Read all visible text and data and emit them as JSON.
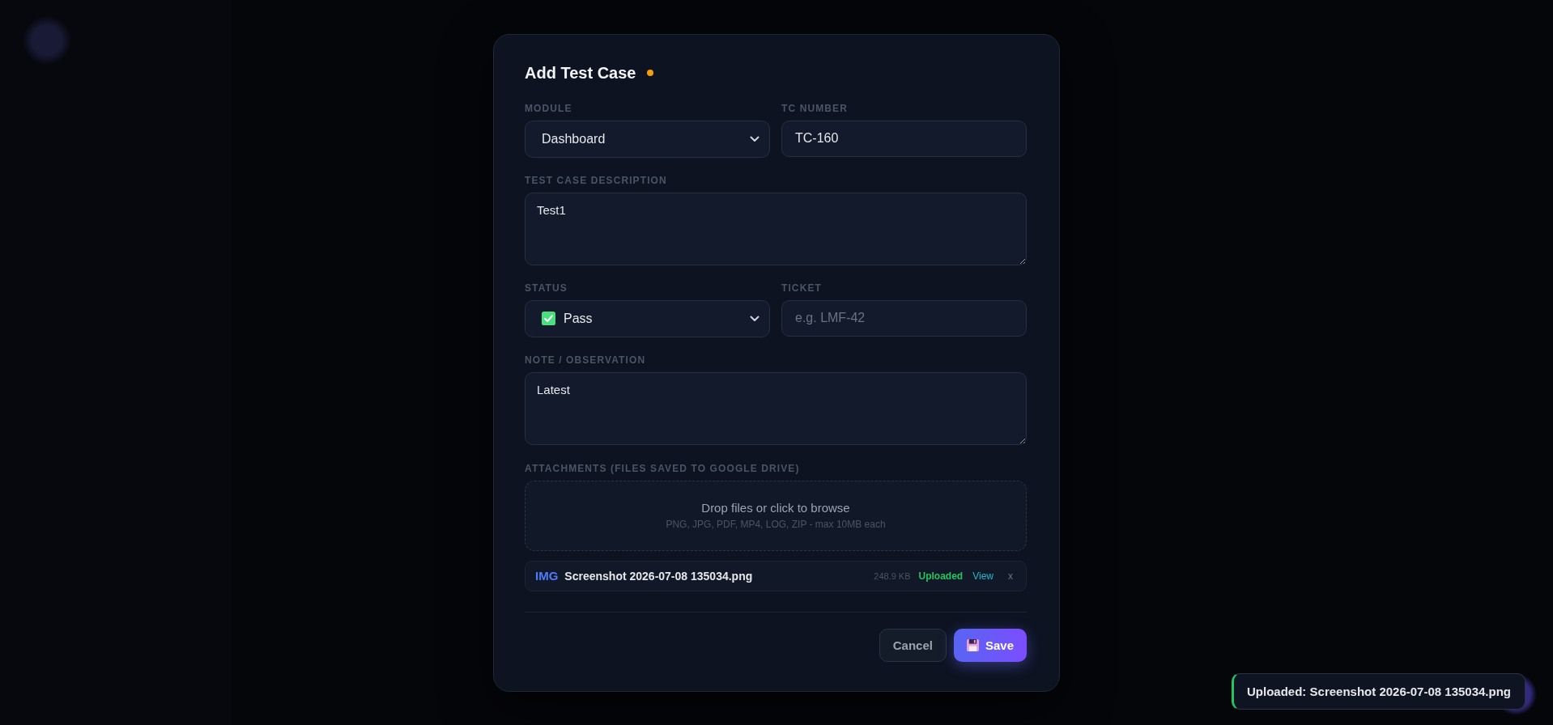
{
  "dialog": {
    "title": "Add Test Case",
    "unsaved": true,
    "fields": [
      {
        "kind": "select",
        "label": "MODULE",
        "value": "Dashboard"
      },
      {
        "kind": "input",
        "label": "TC NUMBER",
        "value": "TC-160"
      },
      {
        "kind": "textarea",
        "label": "TEST CASE DESCRIPTION",
        "value": "Test1"
      },
      {
        "kind": "status-select",
        "label": "STATUS",
        "value": "Pass"
      },
      {
        "kind": "input",
        "label": "TICKET",
        "placeholder": "e.g. LMF-42"
      },
      {
        "kind": "textarea",
        "label": "NOTE / OBSERVATION",
        "value": "Latest"
      }
    ],
    "attachments": {
      "label": "ATTACHMENTS (FILES SAVED TO GOOGLE DRIVE)",
      "dropzone": {
        "title": "Drop files or click to browse",
        "hint": "PNG, JPG, PDF, MP4, LOG, ZIP - max 10MB each"
      },
      "files": [
        {
          "type": "IMG",
          "name": "Screenshot 2026-07-08 135034.png",
          "size": "248.9 KB",
          "status": "Uploaded",
          "action": "View",
          "remove": "x"
        }
      ]
    },
    "buttons": [
      {
        "kind": "secondary",
        "label": "Cancel"
      },
      {
        "kind": "primary",
        "label": "Save"
      }
    ]
  },
  "toast": {
    "kind": "success",
    "message": "Uploaded: Screenshot 2026-07-08 135034.png"
  }
}
